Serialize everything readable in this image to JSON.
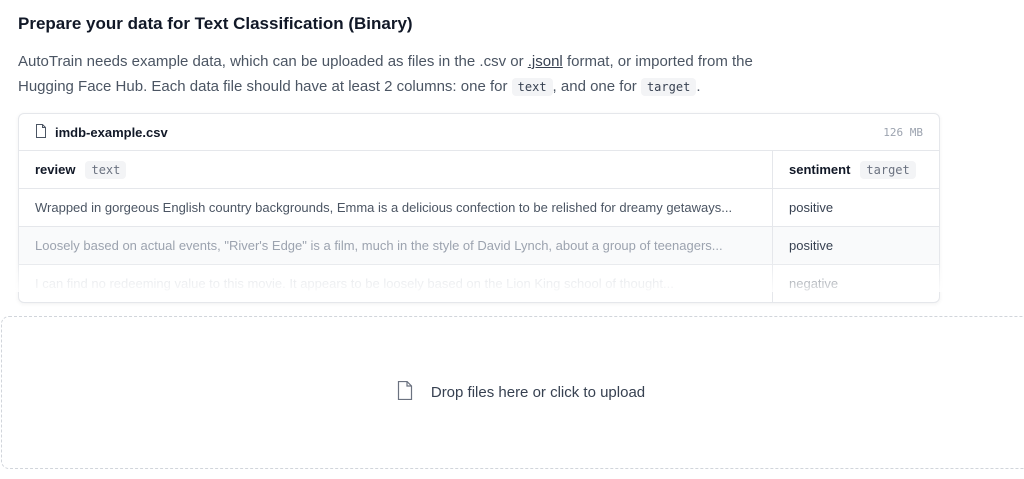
{
  "heading": "Prepare your data for Text Classification (Binary)",
  "description": {
    "part1": "AutoTrain needs example data, which can be uploaded as files in the .csv or ",
    "link": ".jsonl",
    "part2": " format, or imported from the Hugging Face Hub. Each data file should have at least 2 columns: one for ",
    "code1": "text",
    "part3": ", and one for ",
    "code2": "target",
    "part4": "."
  },
  "example_file": {
    "name": "imdb-example.csv",
    "size": "126 MB",
    "columns": [
      {
        "label": "review",
        "tag": "text"
      },
      {
        "label": "sentiment",
        "tag": "target"
      }
    ],
    "rows": [
      {
        "review": "Wrapped in gorgeous English country backgrounds, Emma is a delicious confection to be relished for dreamy getaways...",
        "sentiment": "positive"
      },
      {
        "review": "Loosely based on actual events, \"River's Edge\" is a film, much in the style of David Lynch, about a group of teenagers...",
        "sentiment": "positive"
      },
      {
        "review": "I can find no redeeming value to this movie. It appears to be loosely based on the Lion King school of thought...",
        "sentiment": "negative"
      }
    ]
  },
  "dropzone": {
    "icon": "file-icon",
    "label": "Drop files here or click to upload"
  }
}
